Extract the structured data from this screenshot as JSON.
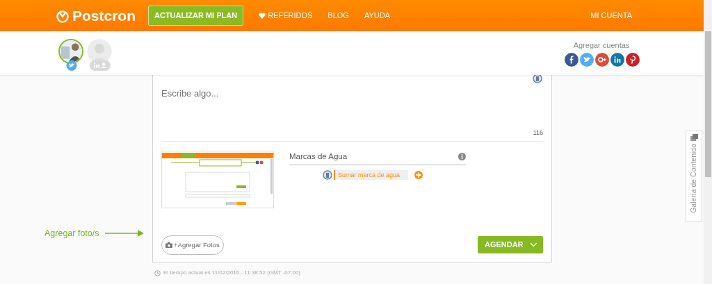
{
  "navbar": {
    "logo": "Postcron",
    "upgrade_button": "ACTUALIZAR MI PLAN",
    "links": [
      {
        "label": "REFERIDOS",
        "kind": "heart"
      },
      {
        "label": "BLOG",
        "kind": "plain"
      },
      {
        "label": "AYUDA",
        "kind": "plain"
      }
    ],
    "account": "MI CUENTA"
  },
  "accounts": {
    "profiles": [
      {
        "kind": "twitter",
        "selected": true
      },
      {
        "kind": "linkedin",
        "selected": false
      }
    ],
    "add_label": "Agregar cuentas",
    "networks": [
      {
        "kind": "facebook",
        "color": "#3b5998"
      },
      {
        "kind": "twitter",
        "color": "#55acee"
      },
      {
        "kind": "googleplus",
        "color": "#dd4b39"
      },
      {
        "kind": "linkedin",
        "color": "#0e76a8"
      },
      {
        "kind": "pinterest",
        "color": "#cb2027"
      }
    ]
  },
  "composer": {
    "placeholder": "Escribe algo...",
    "char_count": "116",
    "watermark": {
      "title": "Marcas de Agua",
      "placeholder": "Sumar marca de agua"
    },
    "add_photos": "+Agregar Fotos",
    "schedule_button": "AGENDAR"
  },
  "annotation": "Agregar foto/s",
  "time_note": "El tiempo actual es 11/02/2016 - 11:38:52 (GMT -07:00)",
  "side_tab": "Galería de Contenido"
}
